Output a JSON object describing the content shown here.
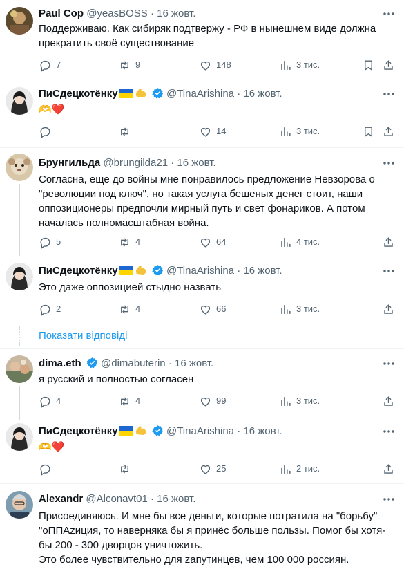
{
  "tweets": [
    {
      "name": "Paul Cop",
      "handle": "@yeasBOSS",
      "date": "16 жовт.",
      "verified": false,
      "flag_emoji": false,
      "text": "Поддерживаю. Как сибиряк подтвержу - РФ в нынешнем виде должна прекратить своё существование",
      "replies": "7",
      "reposts": "9",
      "likes": "148",
      "views": "3 тис."
    },
    {
      "name": "ПиСдецкотёнку",
      "handle": "@TinaArishina",
      "date": "16 жовт.",
      "verified": true,
      "flag_emoji": true,
      "text": "🫶❤️",
      "replies": "",
      "reposts": "",
      "likes": "14",
      "views": "3 тис."
    },
    {
      "name": "Брунгильда",
      "handle": "@brungilda21",
      "date": "16 жовт.",
      "verified": false,
      "flag_emoji": false,
      "text": "Согласна, еще до войны мне понравилось предложение Невзорова о \"революции под ключ\", но такая услуга бешеных денег стоит, наши оппозиционеры предпочли мирный путь и свет фонариков. А потом началась полномасштабная война.",
      "replies": "5",
      "reposts": "4",
      "likes": "64",
      "views": "4 тис."
    },
    {
      "name": "ПиСдецкотёнку",
      "handle": "@TinaArishina",
      "date": "16 жовт.",
      "verified": true,
      "flag_emoji": true,
      "text": "Это даже оппозицией стыдно назвать",
      "replies": "2",
      "reposts": "4",
      "likes": "66",
      "views": "3 тис."
    },
    {
      "name": "dima.eth",
      "handle": "@dimabuterin",
      "date": "16 жовт.",
      "verified": true,
      "flag_emoji": false,
      "text": "я русский и полностью согласен",
      "replies": "4",
      "reposts": "4",
      "likes": "99",
      "views": "3 тис."
    },
    {
      "name": "ПиСдецкотёнку",
      "handle": "@TinaArishina",
      "date": "16 жовт.",
      "verified": true,
      "flag_emoji": true,
      "text": "🫶❤️",
      "replies": "",
      "reposts": "",
      "likes": "25",
      "views": "2 тис."
    },
    {
      "name": "Alexandr",
      "handle": "@Alconavt01",
      "date": "16 жовт.",
      "verified": false,
      "flag_emoji": false,
      "text": "Присоединяюсь. И мне бы все деньги, которые потратила на \"борьбу\" \"оППАzиция, то наверняка бы я принёс больше пользы. Помог бы хотя-бы 200 - 300 дворцов уничтожить.\nЭто более чувствительно для zапутинцев, чем 100 000 россиян.",
      "replies": "",
      "reposts": "",
      "likes": "",
      "views": ""
    }
  ],
  "show_replies": "Показати відповіді",
  "colors": {
    "accent": "#1d9bf0",
    "muted": "#536471",
    "text": "#0f1419",
    "separator": "#eff3f4"
  },
  "icons": [
    "reply-icon",
    "repost-icon",
    "like-icon",
    "views-icon",
    "bookmark-icon",
    "share-icon",
    "more-icon",
    "verified-badge-icon"
  ]
}
